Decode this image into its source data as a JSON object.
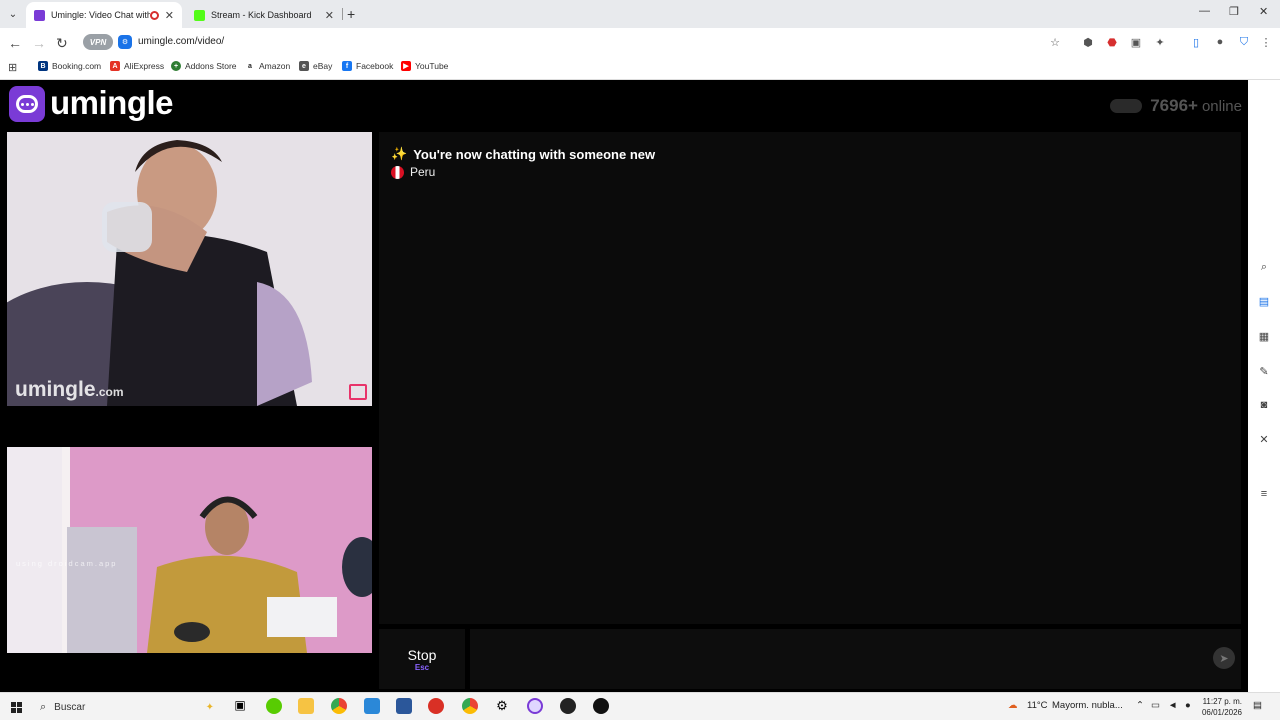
{
  "browser": {
    "tabs": [
      {
        "title": "Umingle: Video Chat with S",
        "active": true,
        "favicon_color": "#7a3bd6"
      },
      {
        "title": "Stream - Kick Dashboard",
        "active": false,
        "favicon_color": "#53fc18"
      }
    ],
    "url": "umingle.com/video/",
    "vpn_label": "VPN",
    "bookmarks": [
      {
        "label": "Booking.com",
        "color": "#003580",
        "glyph": "B"
      },
      {
        "label": "AliExpress",
        "color": "#e43225",
        "glyph": "A"
      },
      {
        "label": "Addons Store",
        "color": "#2e7d32",
        "glyph": "+"
      },
      {
        "label": "Amazon",
        "color": "#222222",
        "glyph": "a"
      },
      {
        "label": "eBay",
        "color": "#555555",
        "glyph": "e"
      },
      {
        "label": "Facebook",
        "color": "#1877f2",
        "glyph": "f"
      },
      {
        "label": "YouTube",
        "color": "#ff0000",
        "glyph": "▶"
      }
    ]
  },
  "site": {
    "logo_text": "umingle",
    "online_count": "7696+",
    "online_label": "online",
    "watermark_main": "umingle",
    "watermark_suffix": ".com",
    "droidcam_text": "using droidcam.app"
  },
  "chat": {
    "system_message": "You're now chatting with someone new",
    "country": "Peru"
  },
  "controls": {
    "stop_label": "Stop",
    "stop_shortcut": "Esc"
  },
  "taskbar": {
    "search_placeholder": "Buscar",
    "weather": "11°C",
    "weather_desc": "Mayorm. nubla...",
    "time": "11:27 p. m.",
    "date": "06/01/2026"
  },
  "colors": {
    "brand": "#7a3bd6",
    "accent": "#8a63ff",
    "report_flag": "#e8336a"
  }
}
